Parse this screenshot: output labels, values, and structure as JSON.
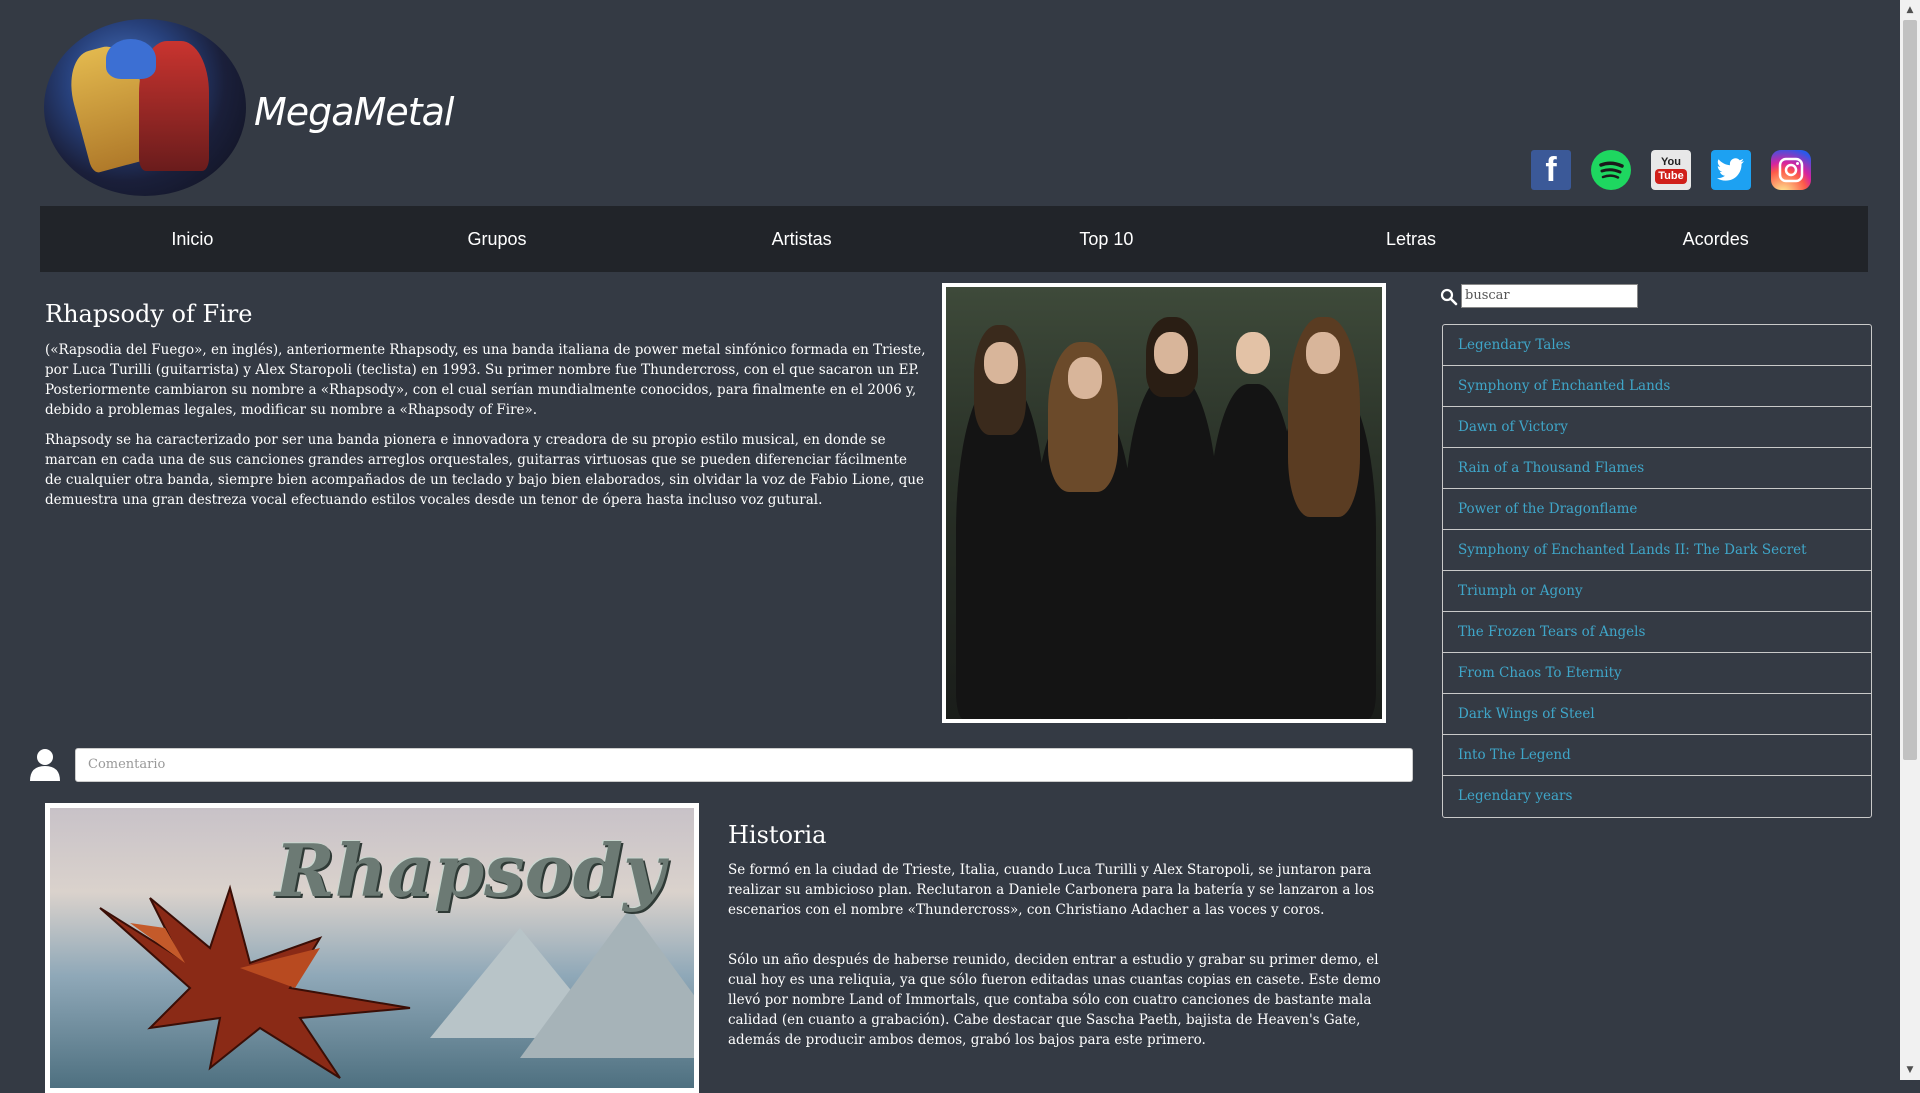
{
  "site": {
    "name": "MegaMetal"
  },
  "socials": [
    {
      "name": "facebook-icon",
      "glyph": "f"
    },
    {
      "name": "spotify-icon",
      "glyph": ""
    },
    {
      "name": "youtube-icon",
      "glyph_top": "You",
      "glyph_bottom": "Tube"
    },
    {
      "name": "twitter-icon",
      "glyph": ""
    },
    {
      "name": "instagram-icon",
      "glyph": ""
    }
  ],
  "nav": [
    "Inicio",
    "Grupos",
    "Artistas",
    "Top 10",
    "Letras",
    "Acordes"
  ],
  "band": {
    "title": "Rhapsody of Fire",
    "paragraphs": [
      "(«Rapsodia del Fuego», en inglés), anteriormente Rhapsody, es una banda italiana de power metal sinfónico formada en Trieste, por Luca Turilli (guitarrista) y Alex Staropoli (teclista) en 1993. Su primer nombre fue Thundercross, con el que sacaron un EP. Posteriormente cambiaron su nombre a «Rhapsody», con el cual serían mundialmente conocidos, para finalmente en el 2006 y, debido a problemas legales, modificar su nombre a «Rhapsody of Fire».",
      "Rhapsody se ha caracterizado por ser una banda pionera e innovadora y creadora de su propio estilo musical, en donde se marcan en cada una de sus canciones grandes arreglos orquestales, guitarras virtuosas que se pueden diferenciar fácilmente de cualquier otra banda, siempre bien acompañados de un teclado y bajo bien elaborados, sin olvidar la voz de Fabio Lione, que demuestra una gran destreza vocal efectuando estilos vocales desde un tenor de ópera hasta incluso voz gutural."
    ]
  },
  "comment": {
    "placeholder": "Comentario"
  },
  "album_art": {
    "logo_text": "Rhapsody"
  },
  "historia": {
    "title": "Historia",
    "paragraphs": [
      "Se formó en la ciudad de Trieste, Italia, cuando Luca Turilli y Alex Staropoli, se juntaron para realizar su ambicioso plan. Reclutaron a Daniele Carbonera para la batería y se lanzaron a los escenarios con el nombre «Thundercross», con Christiano Adacher a las voces y coros.",
      "Sólo un año después de haberse reunido, deciden entrar a estudio y grabar su primer demo, el cual hoy es una reliquia, ya que sólo fueron editadas unas cuantas copias en casete. Este demo llevó por nombre Land of Immortals, que contaba sólo con cuatro canciones de bastante mala calidad (en cuanto a grabación). Cabe destacar que Sascha Paeth, bajista de Heaven's Gate, además de producir ambos demos, grabó los bajos para este primero."
    ]
  },
  "search": {
    "value": "buscar"
  },
  "albums": [
    "Legendary Tales",
    "Symphony of Enchanted Lands",
    "Dawn of Victory",
    "Rain of a Thousand Flames",
    "Power of the Dragonflame",
    "Symphony of Enchanted Lands II: The Dark Secret",
    "Triumph or Agony",
    "The Frozen Tears of Angels",
    "From Chaos To Eternity",
    "Dark Wings of Steel",
    "Into The Legend",
    "Legendary years"
  ],
  "colors": {
    "background": "#343a44",
    "nav": "#212429",
    "link": "#3fa6c9"
  }
}
